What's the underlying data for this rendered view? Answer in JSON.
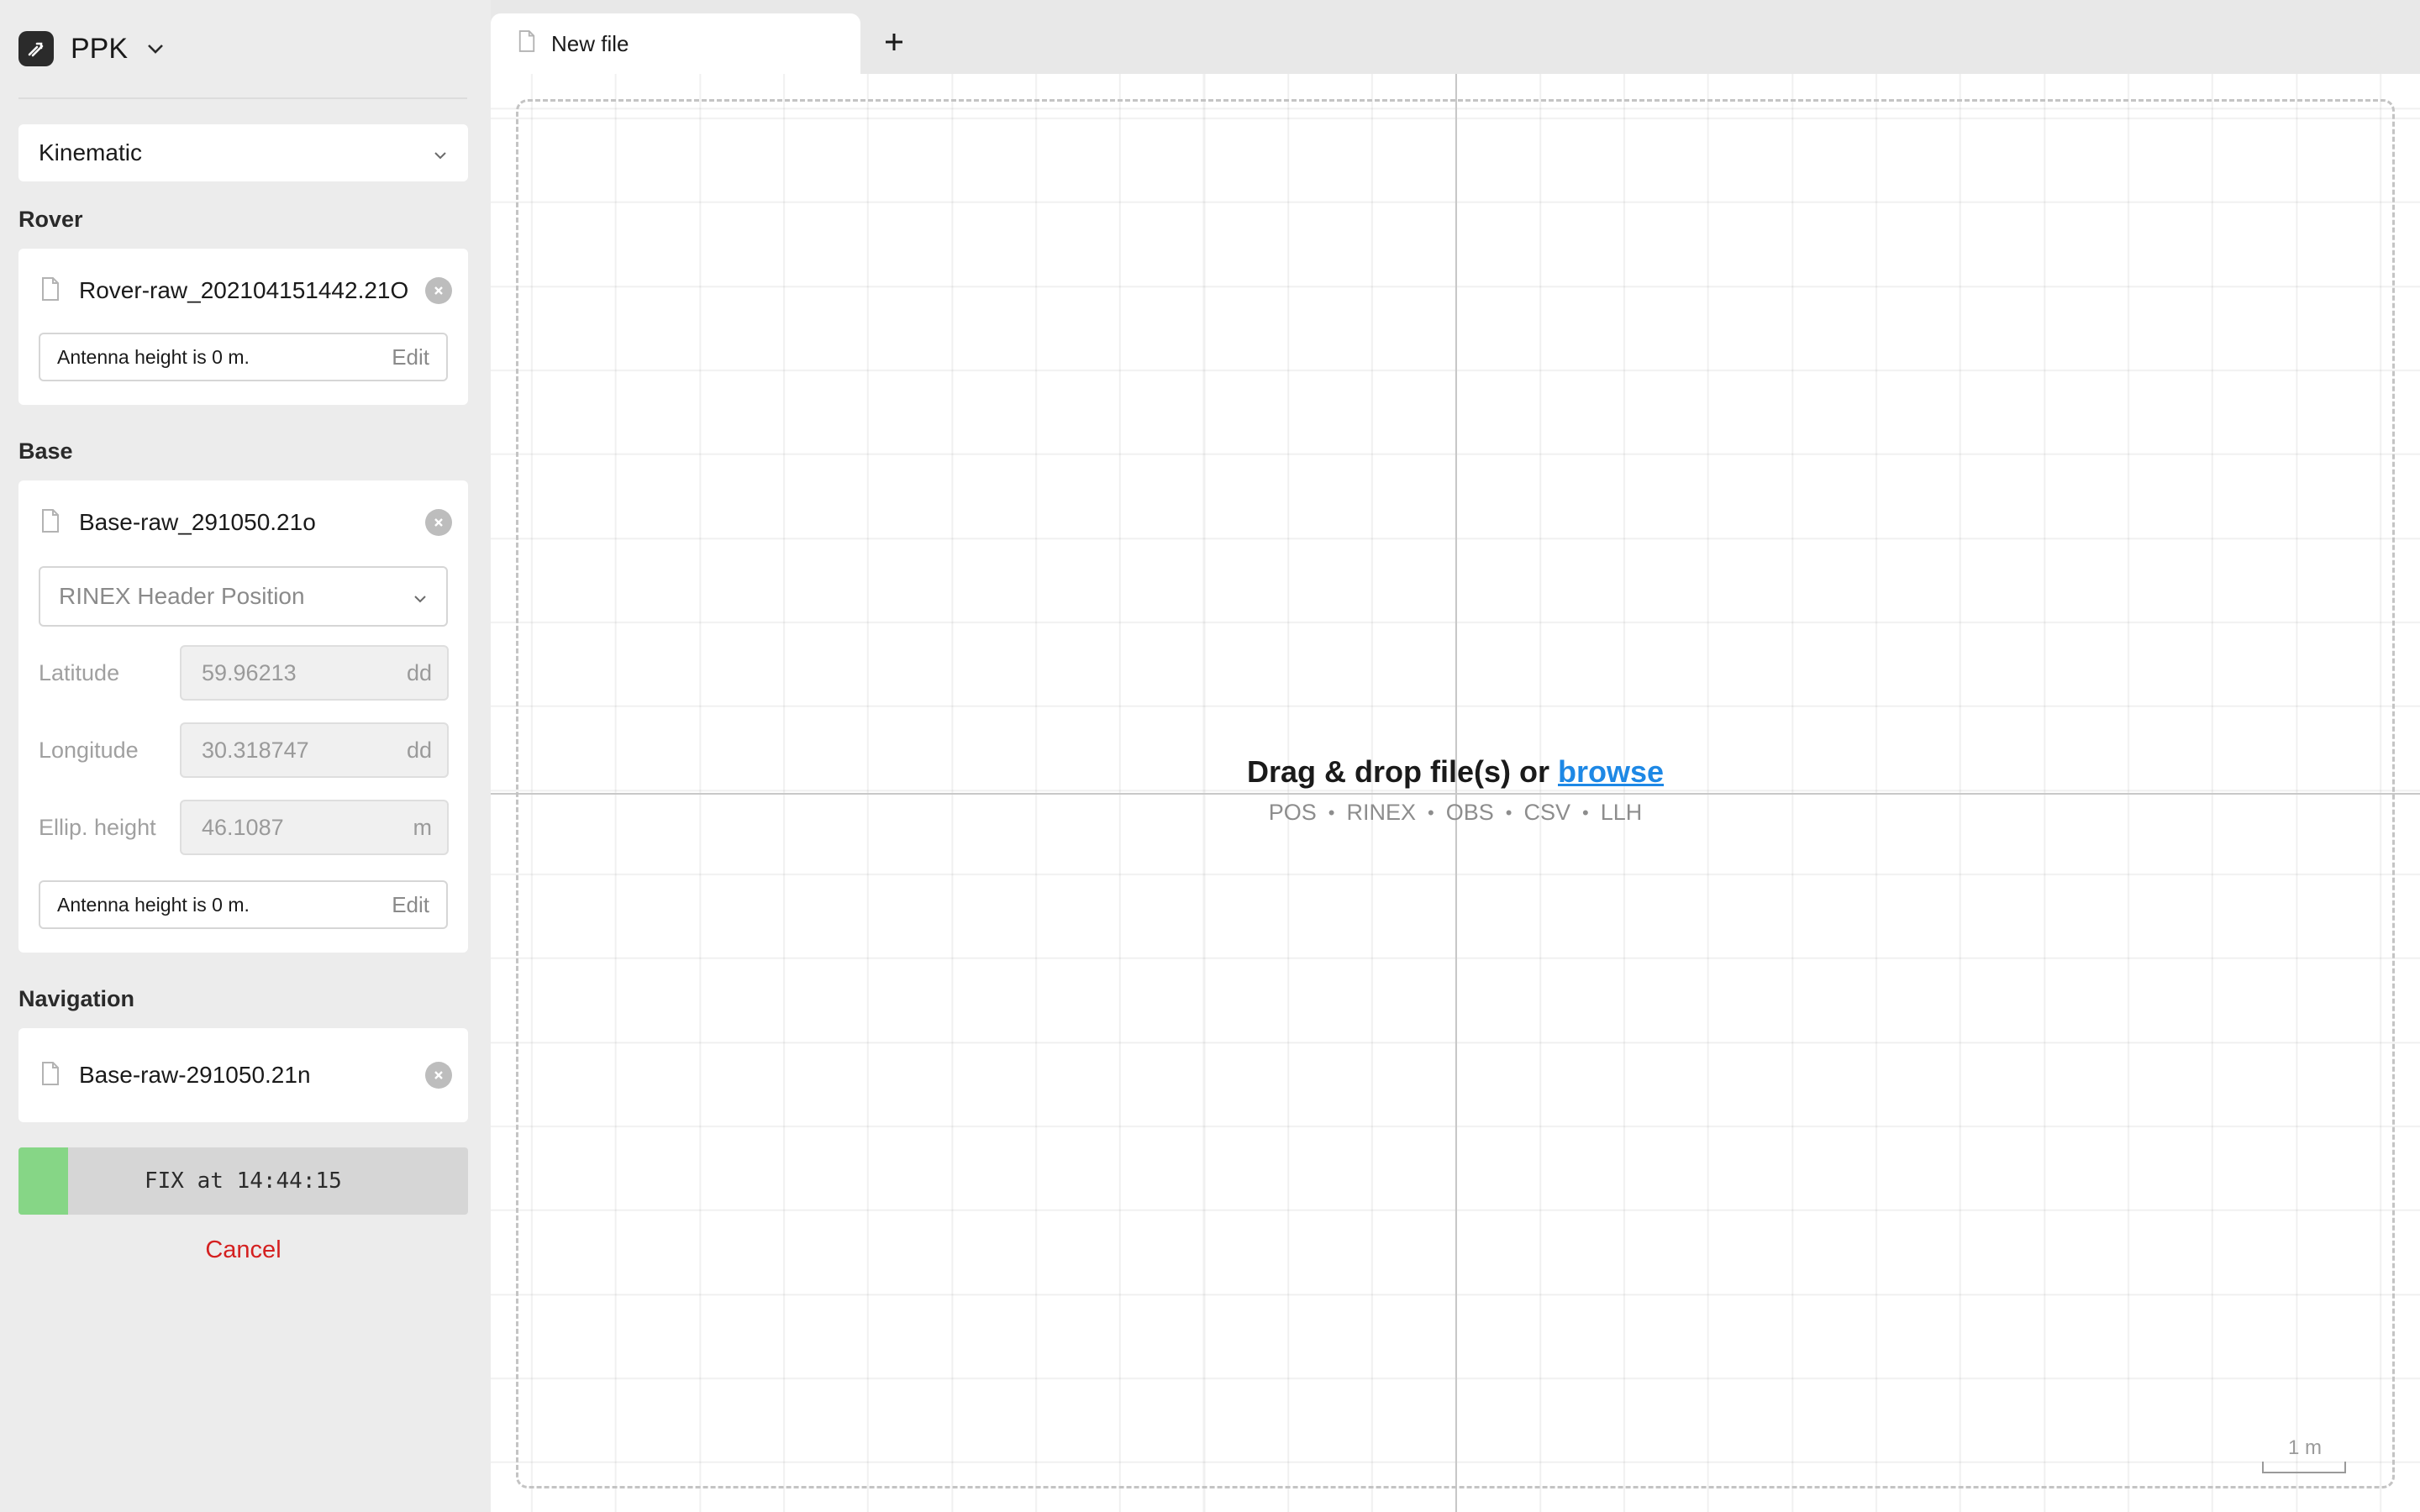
{
  "app": {
    "title": "PPK"
  },
  "mode": {
    "selected": "Kinematic"
  },
  "rover": {
    "label": "Rover",
    "file": "Rover-raw_202104151442.21O",
    "antenna_text": "Antenna height is 0 m.",
    "edit_label": "Edit"
  },
  "base": {
    "label": "Base",
    "file": "Base-raw_291050.21o",
    "position_source": "RINEX Header Position",
    "latitude": {
      "label": "Latitude",
      "value": "59.96213",
      "unit": "dd"
    },
    "longitude": {
      "label": "Longitude",
      "value": "30.318747",
      "unit": "dd"
    },
    "ellip_height": {
      "label": "Ellip. height",
      "value": "46.1087",
      "unit": "m"
    },
    "antenna_text": "Antenna height is 0 m.",
    "edit_label": "Edit"
  },
  "navigation": {
    "label": "Navigation",
    "file": "Base-raw-291050.21n"
  },
  "progress": {
    "status_text": "FIX at 14:44:15",
    "fraction": 0.11,
    "fill_color": "#86d686"
  },
  "cancel_label": "Cancel",
  "tabs": [
    {
      "label": "New file"
    }
  ],
  "canvas": {
    "drop_text": "Drag & drop file(s) or",
    "browse_label": "browse",
    "formats": [
      "POS",
      "RINEX",
      "OBS",
      "CSV",
      "LLH"
    ],
    "scale_label": "1 m"
  },
  "colors": {
    "accent": "#1e88e5",
    "cancel": "#d42020",
    "fix": "#86d686"
  },
  "icons": [
    "ppk-logo-icon",
    "chevron-down-icon",
    "file-icon",
    "clear-icon",
    "plus-icon"
  ]
}
